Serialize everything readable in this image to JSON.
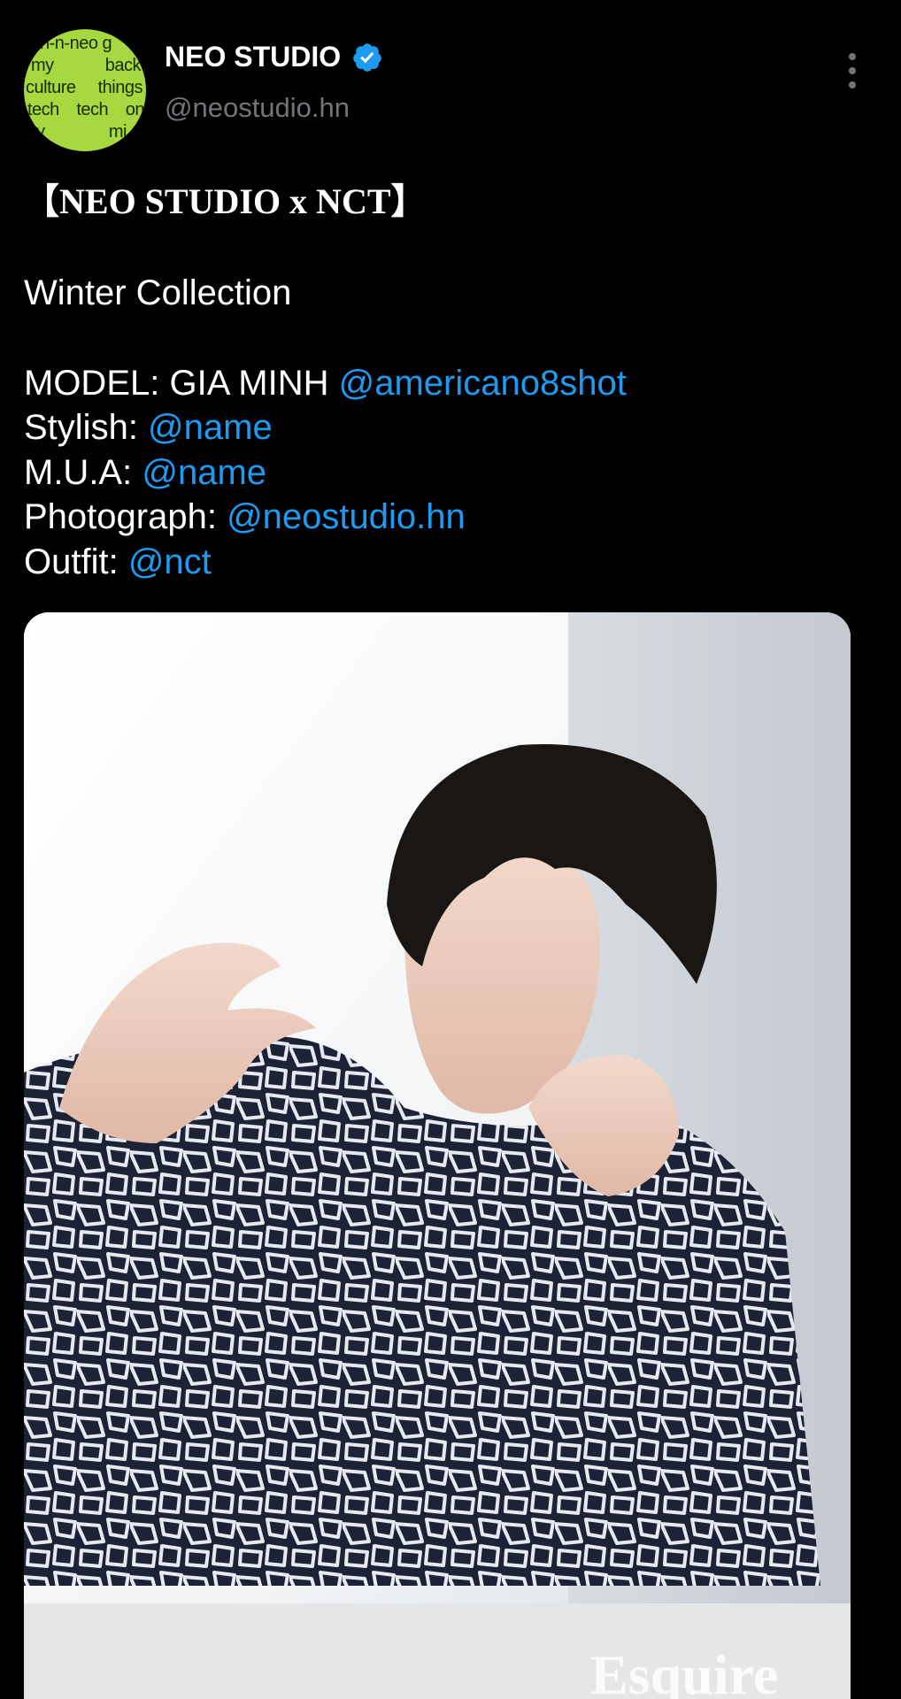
{
  "account": {
    "display_name": "NEO STUDIO",
    "handle": "@neostudio.hn",
    "avatar_lines": [
      [
        "n-n-neo g"
      ],
      [
        "my",
        "back"
      ],
      [
        "culture",
        "things"
      ],
      [
        "tech",
        "tech",
        "on"
      ],
      [
        "y",
        "mi"
      ]
    ],
    "verified_icon": "verified-badge-icon",
    "more_icon": "more-options-icon"
  },
  "tweet": {
    "headline": "【NEO STUDIO x NCT】",
    "subtitle": "Winter Collection",
    "credits": [
      {
        "label": "MODEL: GIA MINH ",
        "mention": "@americano8shot"
      },
      {
        "label": "Stylish: ",
        "mention": "@name"
      },
      {
        "label": "M.U.A: ",
        "mention": "@name"
      },
      {
        "label": "Photograph: ",
        "mention": "@neostudio.hn"
      },
      {
        "label": "Outfit: ",
        "mention": "@nct"
      }
    ]
  },
  "media": {
    "description_icon": "photo-image",
    "watermark": "Esquire"
  },
  "colors": {
    "background": "#000000",
    "mention": "#1d9bf0",
    "secondary_text": "#71767b",
    "avatar_bg": "#a6d83f",
    "verified": "#1d9bf0"
  }
}
